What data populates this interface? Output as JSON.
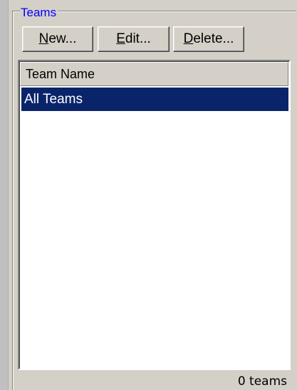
{
  "groupbox": {
    "title": "Teams"
  },
  "toolbar": {
    "new_accel": "N",
    "new_rest": "ew...",
    "edit_accel": "E",
    "edit_rest": "dit...",
    "delete_accel": "D",
    "delete_rest": "elete..."
  },
  "list": {
    "column_header": "Team Name",
    "rows": [
      {
        "label": "All Teams",
        "selected": true
      }
    ],
    "selection_color": "#0a246a"
  },
  "status": {
    "count_text": "0 teams"
  },
  "colors": {
    "title_color": "#0000ff",
    "face": "#d4d0c8"
  }
}
